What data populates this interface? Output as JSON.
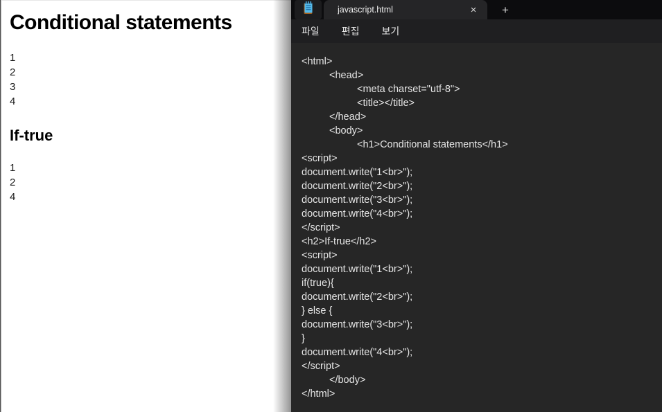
{
  "browser_page": {
    "heading1": "Conditional statements",
    "block1": [
      "1",
      "2",
      "3",
      "4"
    ],
    "heading2": "If-true",
    "block2": [
      "1",
      "2",
      "4"
    ]
  },
  "notepad": {
    "tab_title": "javascript.html",
    "icons": {
      "close": "×",
      "new_tab": "+"
    },
    "menu": {
      "file": "파일",
      "edit": "편집",
      "view": "보기"
    }
  },
  "editor": {
    "lines": [
      "<html>",
      "\t<head>",
      "\t\t<meta charset=\"utf-8\">",
      "\t\t<title></title>",
      "\t</head>",
      "\t<body>",
      "\t\t<h1>Conditional statements</h1>",
      "<script>",
      "document.write(\"1<br>\");",
      "document.write(\"2<br>\");",
      "document.write(\"3<br>\");",
      "document.write(\"4<br>\");",
      "</script>",
      "<h2>If-true</h2>",
      "<script>",
      "document.write(\"1<br>\");",
      "if(true){",
      "document.write(\"2<br>\");",
      "} else {",
      "document.write(\"3<br>\");",
      "}",
      "document.write(\"4<br>\");",
      "</script>",
      "\t</body>",
      "</html>"
    ]
  }
}
